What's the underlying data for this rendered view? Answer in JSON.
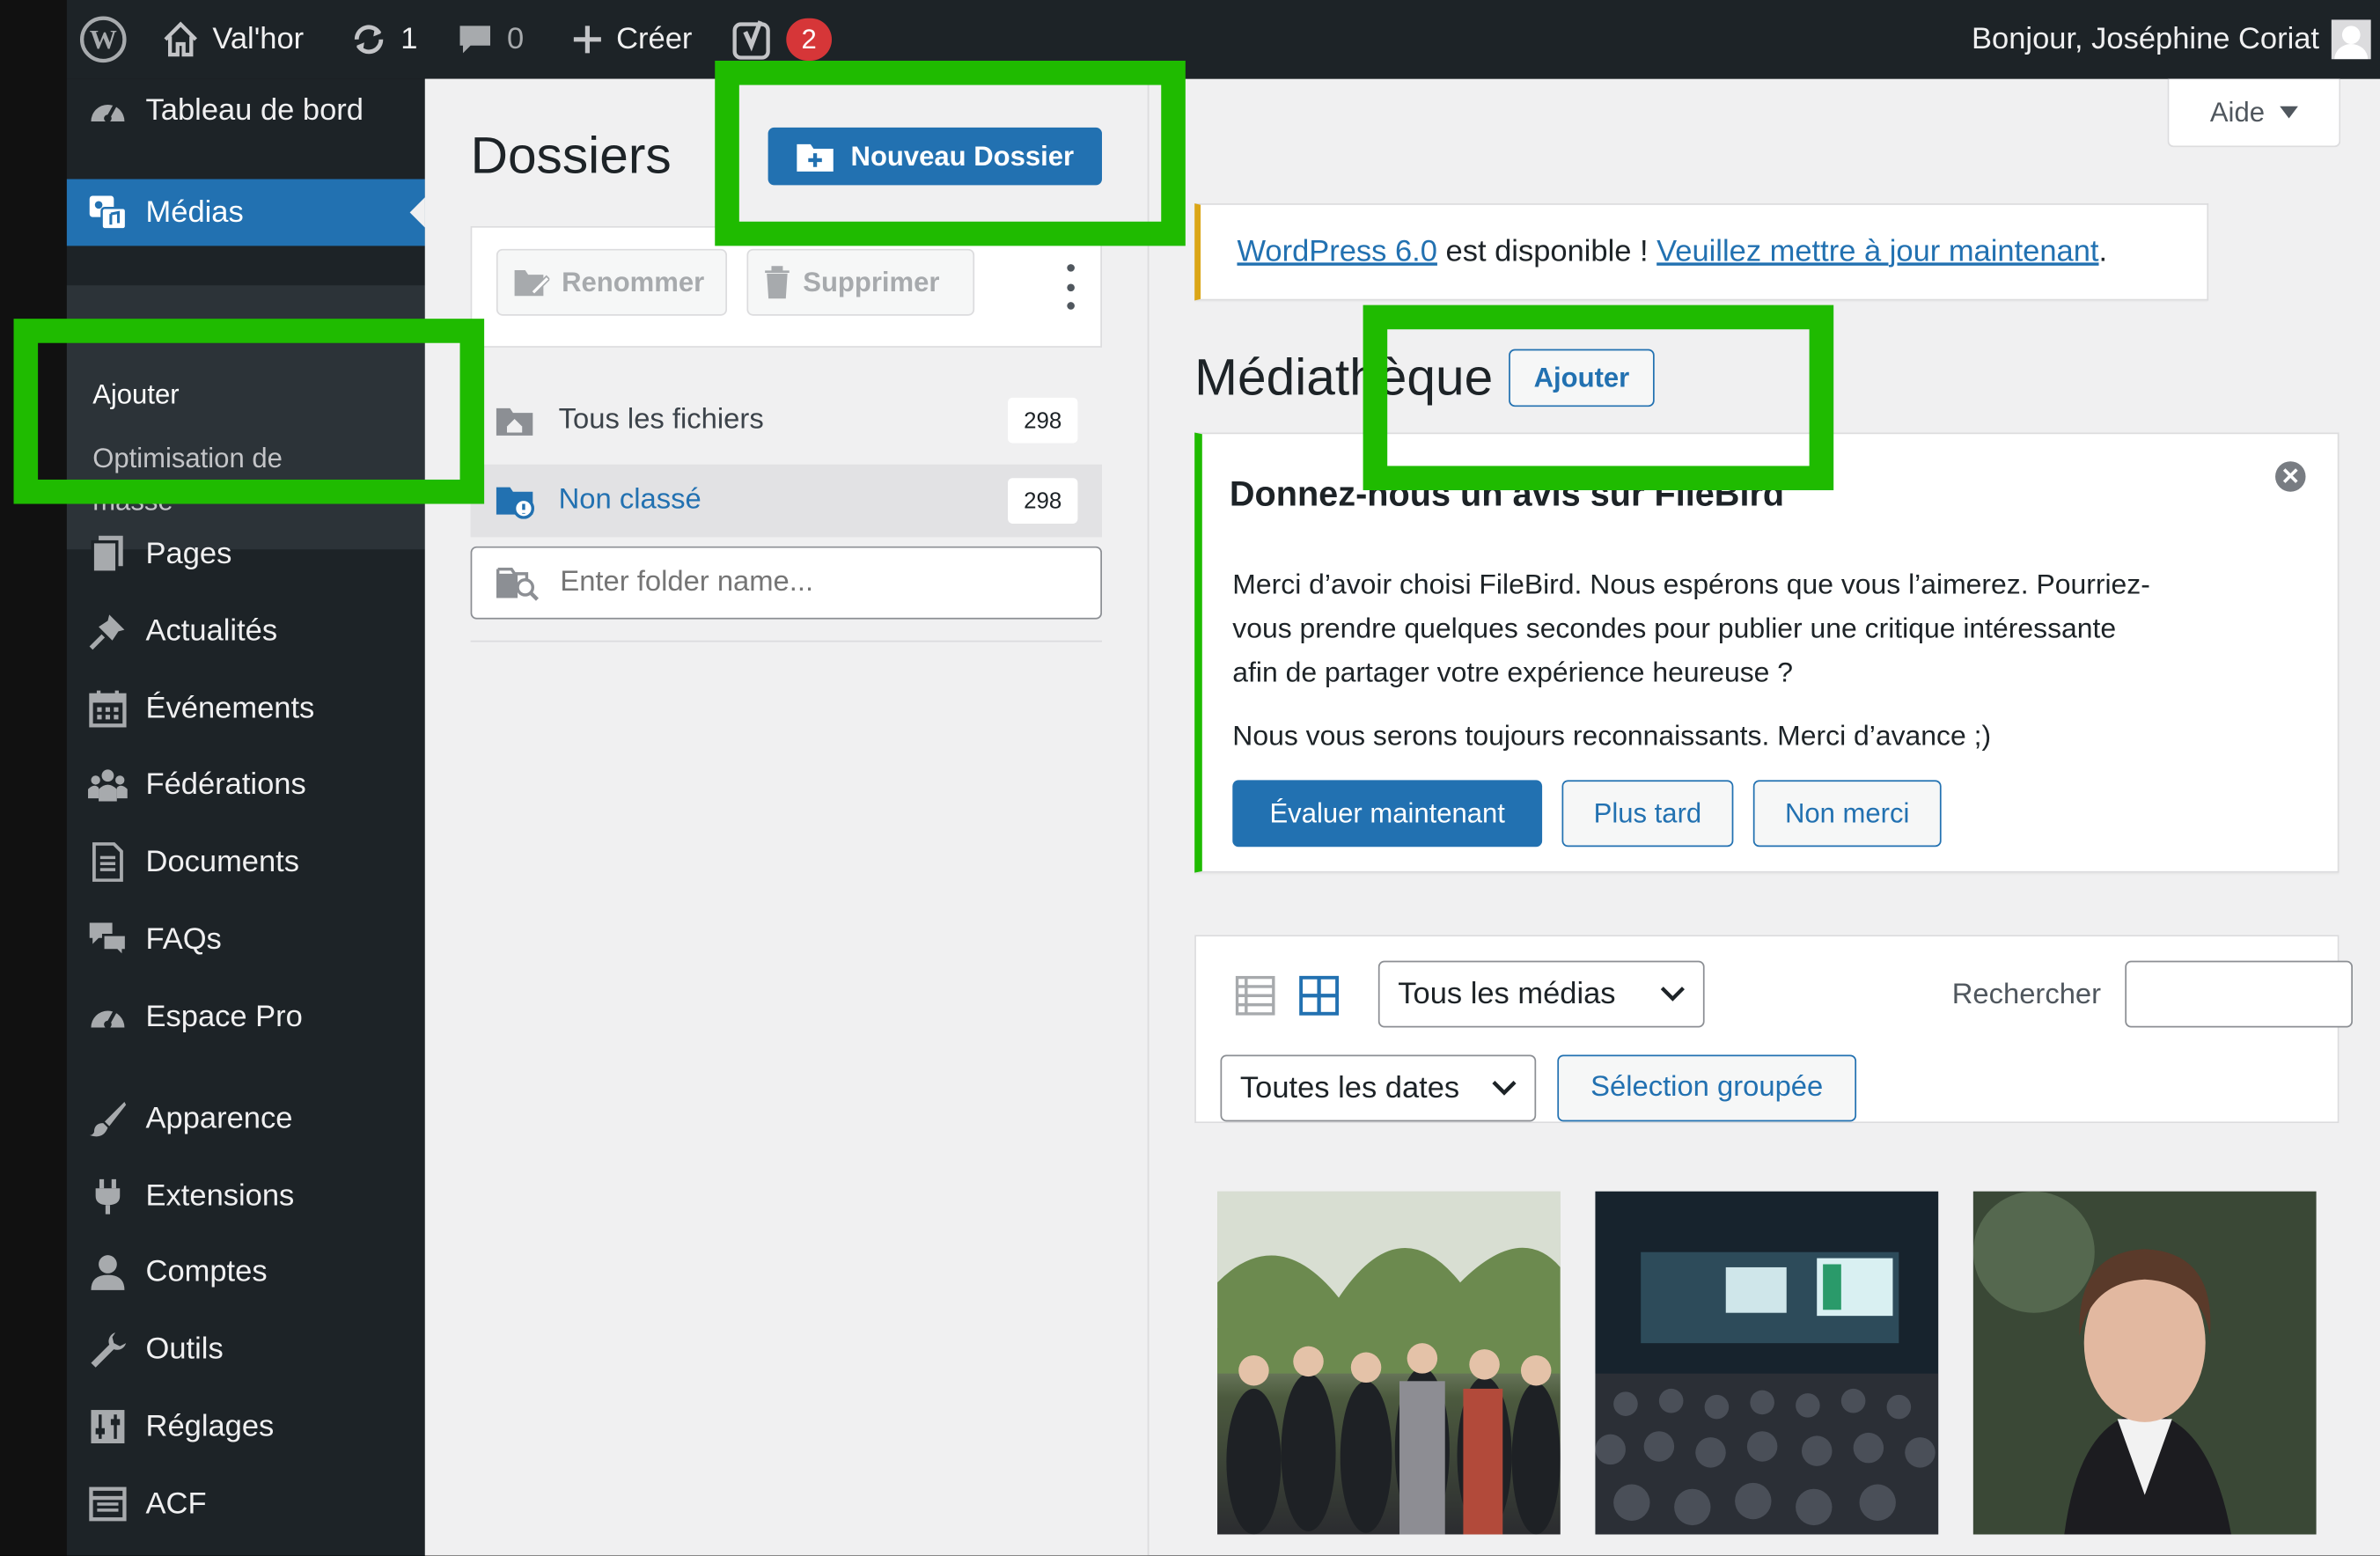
{
  "adminbar": {
    "site_name": "Val'hor",
    "updates_count": "1",
    "comments_count": "0",
    "new_label": "Créer",
    "yoast_badge": "2",
    "greeting": "Bonjour, Joséphine Coriat"
  },
  "sidebar": {
    "items": [
      {
        "label": "Tableau de bord",
        "icon": "dashboard-icon"
      },
      {
        "label": "Médias",
        "icon": "media-icon",
        "active": true
      },
      {
        "label": "Pages",
        "icon": "pages-icon"
      },
      {
        "label": "Actualités",
        "icon": "pin-icon"
      },
      {
        "label": "Événements",
        "icon": "calendar-icon"
      },
      {
        "label": "Fédérations",
        "icon": "groups-icon"
      },
      {
        "label": "Documents",
        "icon": "document-icon"
      },
      {
        "label": "FAQs",
        "icon": "comments-icon"
      },
      {
        "label": "Espace Pro",
        "icon": "dashboard-icon"
      },
      {
        "label": "Apparence",
        "icon": "brush-icon"
      },
      {
        "label": "Extensions",
        "icon": "plugin-icon"
      },
      {
        "label": "Comptes",
        "icon": "user-icon"
      },
      {
        "label": "Outils",
        "icon": "wrench-icon"
      },
      {
        "label": "Réglages",
        "icon": "settings-icon"
      },
      {
        "label": "ACF",
        "icon": "acf-icon"
      }
    ],
    "submenu": {
      "add": "Ajouter",
      "bulk_opt_line1": "Optimisation de",
      "bulk_opt_line2": "masse"
    }
  },
  "folders": {
    "title": "Dossiers",
    "new_folder_button": "Nouveau Dossier",
    "rename_button": "Renommer",
    "delete_button": "Supprimer",
    "all_files_label": "Tous les fichiers",
    "all_files_count": "298",
    "uncategorized_label": "Non classé",
    "uncategorized_count": "298",
    "search_placeholder": "Enter folder name..."
  },
  "help_button": "Aide",
  "update_notice": {
    "link1": "WordPress 6.0",
    "text": " est disponible ! ",
    "link2": "Veuillez mettre à jour maintenant",
    "end": "."
  },
  "library": {
    "title": "Médiathèque",
    "add_button": "Ajouter"
  },
  "filebird_notice": {
    "title": "Donnez-nous un avis sur FileBird",
    "p1_line1": "Merci d’avoir choisi FileBird. Nous espérons que vous l’aimerez. Pourriez-",
    "p1_line2": "vous prendre quelques secondes pour publier une critique intéressante",
    "p1_line3": "afin de partager votre expérience heureuse ?",
    "p2": "Nous vous serons toujours reconnaissants. Merci d’avance ;)",
    "rate_now": "Évaluer maintenant",
    "later": "Plus tard",
    "no_thanks": "Non merci"
  },
  "toolbar": {
    "media_filter": "Tous les médias",
    "search_label": "Rechercher",
    "date_filter": "Toutes les dates",
    "bulk_select": "Sélection groupée"
  },
  "colors": {
    "admin_dark": "#1d2327",
    "wp_blue": "#2271b1",
    "highlight_green": "#1fbb00",
    "badge_red": "#d63638"
  }
}
